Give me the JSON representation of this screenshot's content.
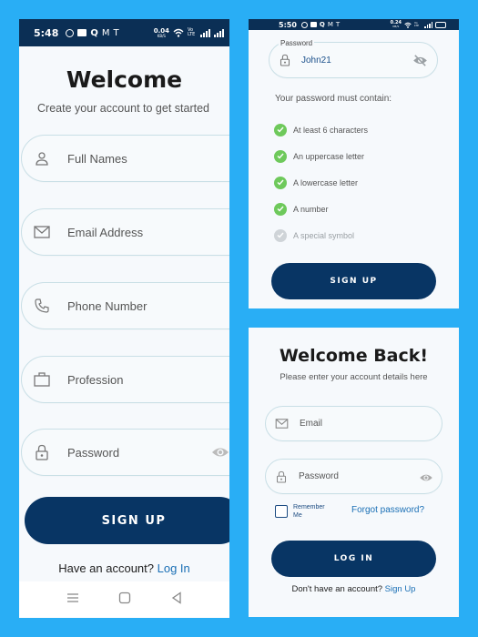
{
  "signup": {
    "status": {
      "time": "5:48",
      "net_speed": "0.04",
      "net_unit": "KB/S",
      "signal_label": "Vo LTE"
    },
    "title": "Welcome",
    "subtitle": "Create your account to get started",
    "fields": {
      "full_names": "Full Names",
      "email": "Email Address",
      "phone": "Phone Number",
      "profession": "Profession",
      "password": "Password"
    },
    "signup_button": "SIGN UP",
    "have_account": "Have an account?",
    "login_link": "Log In"
  },
  "password_rules": {
    "status": {
      "time": "5:50",
      "net_speed": "0.24",
      "net_unit": "KB/S",
      "signal_label": "Vo LTE"
    },
    "password_label": "Password",
    "password_value": "John21",
    "must_contain": "Your password must contain:",
    "rules": [
      {
        "text": "At least 6 characters",
        "met": true
      },
      {
        "text": "An uppercase letter",
        "met": true
      },
      {
        "text": "A lowercase letter",
        "met": true
      },
      {
        "text": "A number",
        "met": true
      },
      {
        "text": "A special symbol",
        "met": false
      }
    ],
    "signup_button": "SIGN UP"
  },
  "login": {
    "title": "Welcome Back!",
    "subtitle": "Please enter your account details here",
    "email_placeholder": "Email",
    "password_placeholder": "Password",
    "remember_me": "Remember Me",
    "forgot_password": "Forgot password?",
    "login_button": "LOG IN",
    "no_account": "Don't have an account?",
    "signup_link": "Sign Up"
  },
  "colors": {
    "background": "#29aef5",
    "primary_button": "#083564",
    "status_bar": "#0b2f55",
    "link": "#1a6fb5",
    "check_met": "#6ec95b",
    "check_unmet": "#cfd4d8"
  }
}
